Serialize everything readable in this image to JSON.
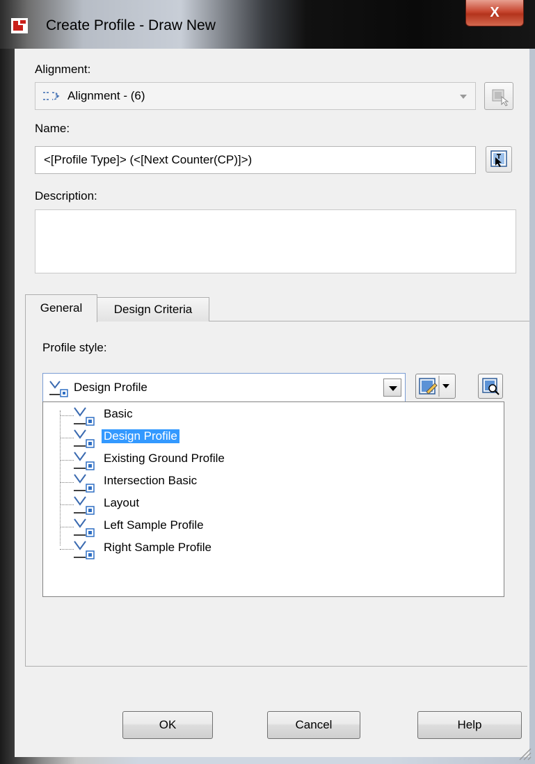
{
  "window": {
    "title": "Create Profile - Draw New",
    "close_label": "X"
  },
  "alignment": {
    "label": "Alignment:",
    "value": "Alignment - (6)"
  },
  "name": {
    "label": "Name:",
    "value": "<[Profile Type]> (<[Next Counter(CP)]>)"
  },
  "description": {
    "label": "Description:",
    "value": ""
  },
  "tabs": [
    {
      "label": "General",
      "active": true
    },
    {
      "label": "Design Criteria",
      "active": false
    }
  ],
  "profile_style": {
    "label": "Profile style:",
    "selected": "Design Profile",
    "options": [
      {
        "label": "Basic",
        "selected": false
      },
      {
        "label": "Design Profile",
        "selected": true
      },
      {
        "label": "Existing Ground Profile",
        "selected": false
      },
      {
        "label": "Intersection Basic",
        "selected": false
      },
      {
        "label": "Layout",
        "selected": false
      },
      {
        "label": "Left Sample Profile",
        "selected": false
      },
      {
        "label": "Right Sample Profile",
        "selected": false
      }
    ]
  },
  "buttons": {
    "ok": "OK",
    "cancel": "Cancel",
    "help": "Help"
  },
  "colors": {
    "selection": "#3399ff",
    "close_button": "#c7462f",
    "dialog_bg": "#f0f0f0"
  }
}
